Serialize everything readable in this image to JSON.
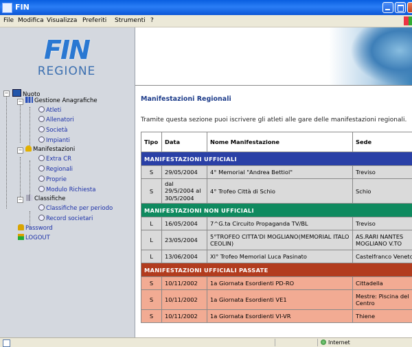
{
  "window": {
    "title": "FIN"
  },
  "menu": [
    "File",
    "Modifica",
    "Visualizza",
    "Preferiti",
    "Strumenti",
    "?"
  ],
  "logo": {
    "text": "FIN",
    "subtitle": "REGIONE"
  },
  "nav": {
    "nuoto": "Nuoto",
    "gestione": "Gestione Anagrafiche",
    "atleti": "Atleti",
    "allenatori": "Allenatori",
    "societa": "Società",
    "impianti": "Impianti",
    "manifestazioni": "Manifestazioni",
    "extra_cr": "Extra CR",
    "regionali": "Regionali",
    "proprie": "Proprie",
    "modulo_richiesta": "Modulo Richiesta",
    "classifiche": "Classifiche",
    "classifiche_periodo": "Classifiche per periodo",
    "record_societari": "Record societari",
    "password": "Password",
    "logout": "LOGOUT"
  },
  "main": {
    "title": "Manifestazioni Regionali",
    "intro": "Tramite questa sezione puoi iscrivere gli atleti alle gare delle manifestazioni regionali.",
    "columns": {
      "tipo": "Tipo",
      "data": "Data",
      "nome": "Nome Manifestazione",
      "sede": "Sede"
    },
    "groups": {
      "ufficiali": "MANIFESTAZIONI UFFICIALI",
      "non_ufficiali": "MANIFESTAZIONI NON UFFICIALI",
      "passate": "MANIFESTAZIONI UFFICIALI PASSATE"
    },
    "rows": [
      {
        "tipo": "S",
        "data": "29/05/2004",
        "nome": "4° Memorial \"Andrea Bettiol\"",
        "sede": "Treviso"
      },
      {
        "tipo": "S",
        "data": "dal 29/5/2004 al 30/5/2004",
        "nome": "4° Trofeo Città di Schio",
        "sede": "Schio"
      },
      {
        "tipo": "L",
        "data": "16/05/2004",
        "nome": "7^G.ta Circuito Propaganda TV/BL",
        "sede": "Treviso"
      },
      {
        "tipo": "L",
        "data": "23/05/2004",
        "nome": "5°TROFEO CITTA'DI MOGLIANO(MEMORIAL ITALO CEOLIN)",
        "sede": "AS.RARI NANTES MOGLIANO V.TO"
      },
      {
        "tipo": "L",
        "data": "13/06/2004",
        "nome": "XI° Trofeo Memorial Luca Pasinato",
        "sede": "Castelfranco Veneto"
      },
      {
        "tipo": "S",
        "data": "10/11/2002",
        "nome": "1a Giornata Esordienti PD-RO",
        "sede": "Cittadella"
      },
      {
        "tipo": "S",
        "data": "10/11/2002",
        "nome": "1a Giornata Esordienti VE1",
        "sede": "Mestre: Piscina del Centro"
      },
      {
        "tipo": "S",
        "data": "10/11/2002",
        "nome": "1a Giornata Esordienti VI-VR",
        "sede": "Thiene"
      }
    ]
  },
  "status": {
    "zone": "Internet"
  },
  "colors": {
    "group_blue": "#2a40a6",
    "group_green": "#0f8a5f",
    "group_red": "#b23c1e",
    "row_gray": "#dadada",
    "row_salmon": "#f2ab93"
  }
}
